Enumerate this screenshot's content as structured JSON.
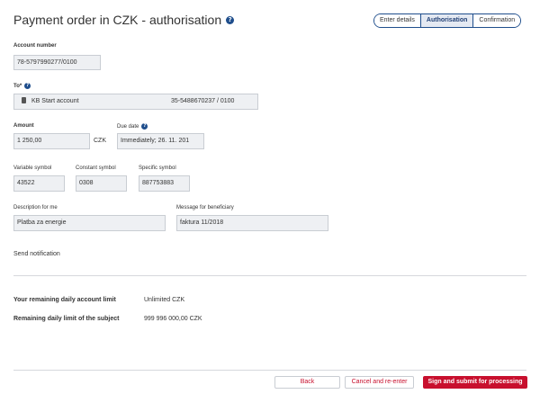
{
  "header": {
    "title": "Payment order in CZK - authorisation",
    "steps": [
      "Enter details",
      "Authorisation",
      "Confirmation"
    ]
  },
  "form": {
    "account_number_label": "Account number",
    "account_number_value": "78-5797990277/0100",
    "to_label": "To*",
    "to_name": "KB Start account",
    "to_account": "35-5488670237 / 0100",
    "amount_label": "Amount",
    "amount_value": "1 250,00",
    "currency": "CZK",
    "due_date_label": "Due date",
    "due_date_value": "Immediately; 26. 11. 201",
    "variable_symbol_label": "Variable symbol",
    "variable_symbol_value": "43522",
    "constant_symbol_label": "Constant symbol",
    "constant_symbol_value": "0308",
    "specific_symbol_label": "Specific symbol",
    "specific_symbol_value": "887753883",
    "description_label": "Description for me",
    "description_value": "Platba za energie",
    "message_label": "Message for beneficiary",
    "message_value": "faktura 11/2018",
    "send_notification": "Send notification"
  },
  "limits": {
    "daily_account_label": "Your remaining daily account limit",
    "daily_account_value": "Unlimited CZK",
    "subject_label": "Remaining daily limit of the subject",
    "subject_value": "999 996 000,00 CZK"
  },
  "actions": {
    "back": "Back",
    "cancel": "Cancel and re-enter",
    "submit": "Sign and submit for processing"
  },
  "colors": {
    "brand_red": "#c8102e",
    "accent_blue": "#1f4e8c"
  }
}
